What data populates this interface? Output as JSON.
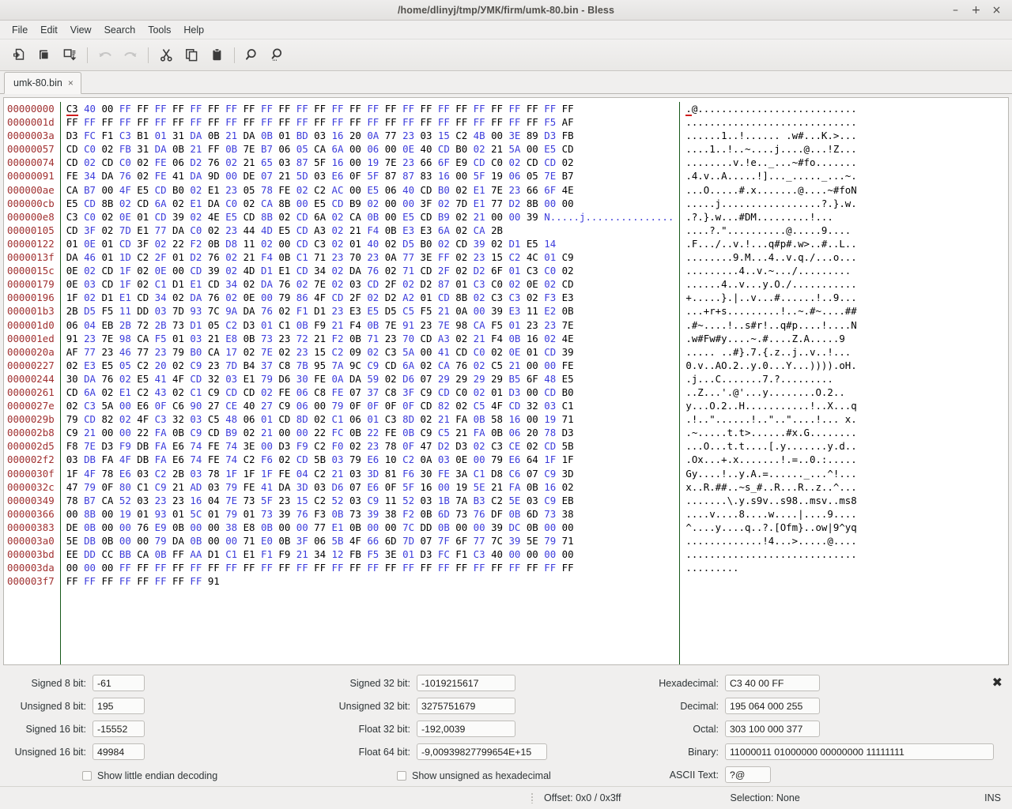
{
  "window": {
    "title": "/home/dlinyj/tmp/УМК/firm/umk-80.bin - Bless",
    "minimize": "–",
    "maximize": "+",
    "close": "×"
  },
  "menubar": {
    "items": [
      {
        "label": "File"
      },
      {
        "label": "Edit"
      },
      {
        "label": "View"
      },
      {
        "label": "Search"
      },
      {
        "label": "Tools"
      },
      {
        "label": "Help"
      }
    ]
  },
  "toolbar": {
    "buttons": [
      {
        "name": "new-icon",
        "tooltip": "New",
        "enabled": true
      },
      {
        "name": "open-icon",
        "tooltip": "Open",
        "enabled": true
      },
      {
        "name": "save-icon",
        "tooltip": "Save",
        "enabled": true
      },
      {
        "name": "undo-icon",
        "tooltip": "Undo",
        "enabled": false
      },
      {
        "name": "redo-icon",
        "tooltip": "Redo",
        "enabled": false
      },
      {
        "name": "cut-icon",
        "tooltip": "Cut",
        "enabled": true
      },
      {
        "name": "copy-icon",
        "tooltip": "Copy",
        "enabled": true
      },
      {
        "name": "paste-icon",
        "tooltip": "Paste",
        "enabled": true
      },
      {
        "name": "find-icon",
        "tooltip": "Find",
        "enabled": true
      },
      {
        "name": "find-replace-icon",
        "tooltip": "Find and Replace",
        "enabled": true
      }
    ]
  },
  "tabs": [
    {
      "label": "umk-80.bin",
      "close": "×",
      "active": true
    }
  ],
  "hexview": {
    "bytes_per_row": 29,
    "rows": [
      {
        "offset": "00000000",
        "hex": "C3 40 00 FF FF FF FF FF FF FF FF FF FF FF FF FF FF FF FF FF FF FF FF FF FF FF FF FF FF",
        "ascii": ".@..........................."
      },
      {
        "offset": "0000001d",
        "hex": "FF FF FF FF FF FF FF FF FF FF FF FF FF FF FF FF FF FF FF FF FF FF FF FF FF FF FF F5 AF",
        "ascii": "............................."
      },
      {
        "offset": "0000003a",
        "hex": "D3 FC F1 C3 B1 01 31 DA 0B 21 DA 0B 01 BD 03 16 20 0A 77 23 03 15 C2 4B 00 3E 89 D3 FB",
        "ascii": "......1..!...... .w#...K.>..."
      },
      {
        "offset": "00000057",
        "hex": "CD C0 02 FB 31 DA 0B 21 FF 0B 7E B7 06 05 CA 6A 00 06 00 0E 40 CD B0 02 21 5A 00 E5 CD",
        "ascii": "....1..!..~....j....@...!Z..."
      },
      {
        "offset": "00000074",
        "hex": "CD 02 CD C0 02 FE 06 D2 76 02 21 65 03 87 5F 16 00 19 7E 23 66 6F E9 CD C0 02 CD CD 02",
        "ascii": "........v.!e.._...~#fo......."
      },
      {
        "offset": "00000091",
        "hex": "FE 34 DA 76 02 FE 41 DA 9D 00 DE 07 21 5D 03 E6 0F 5F 87 87 83 16 00 5F 19 06 05 7E B7",
        "ascii": ".4.v..A.....!]..._....._...~."
      },
      {
        "offset": "000000ae",
        "hex": "CA B7 00 4F E5 CD B0 02 E1 23 05 78 FE 02 C2 AC 00 E5 06 40 CD B0 02 E1 7E 23 66 6F 4E",
        "ascii": "...O.....#.x.......@....~#foN"
      },
      {
        "offset": "000000cb",
        "hex": "E5 CD 8B 02 CD 6A 02 E1 DA C0 02 CA 8B 00 E5 CD B9 02 00 00 3F 02 7D E1 77 D2 8B 00 00",
        "ascii": ".....j.................?.}.w..."
      },
      {
        "offset": "000000e8",
        "hex": "C3 C0 02 0E 01 CD 39 02 4E E5 CD 8B 02 CD 6A 02 CA 0B 00 E5 CD B9 02 21 00 00 39 N.....j..............."
      },
      {
        "offset": "00000105",
        "hex": "CD 3F 02 7D E1 77 DA C0 02 23 44 4D E5 CD A3 02 21 F4 0B E3 E3 6A 02 CA 2B",
        "ascii": ".?.}.w...#DM.........!....j..+"
      },
      {
        "offset": "00000122",
        "hex": "01 0E 01 CD 3F 02 22 F2 0B D8 11 02 00 CD C3 02 01 40 02 D5 B0 02 CD 39 02 D1 E5 14",
        "ascii": "....?.\"..........@.....9...."
      },
      {
        "offset": "0000013f",
        "hex": "DA 46 01 1D C2 2F 01 D2 76 02 21 F4 0B C1 71 23 70 23 0A 77 3E FF 02 23 15 C2 4C 01 C9",
        "ascii": ".F.../..v.!...q#p#.w>..#..L.."
      },
      {
        "offset": "0000015c",
        "hex": "0E 02 CD 1F 02 0E 00 CD 39 02 4D D1 E1 CD 34 02 DA 76 02 71 CD 2F 02 D2 6F 01 C3 C0 02",
        "ascii": "........9.M...4..v.q./...o..."
      },
      {
        "offset": "00000179",
        "hex": "0E 03 CD 1F 02 C1 D1 E1 CD 34 02 DA 76 02 7E 02 03 CD 2F 02 D2 87 01 C3 C0 02 0E 02 CD",
        "ascii": ".........4..v.~.../........."
      },
      {
        "offset": "00000196",
        "hex": "1F 02 D1 E1 CD 34 02 DA 76 02 0E 00 79 86 4F CD 2F 02 D2 A2 01 CD 8B 02 C3 C3 02 F3 E3",
        "ascii": "......4..v...y.O./..........."
      },
      {
        "offset": "000001b3",
        "hex": "2B D5 F5 11 DD 03 7D 93 7C 9A DA 76 02 F1 D1 23 E3 E5 D5 C5 F5 21 0A 00 39 E3 11 E2 0B",
        "ascii": "+.....}.|..v...#......!..9...."
      },
      {
        "offset": "000001d0",
        "hex": "06 04 EB 2B 72 2B 73 D1 05 C2 D3 01 C1 0B F9 21 F4 0B 7E 91 23 7E 98 CA F5 01 23 23 7E",
        "ascii": "...+r+s.........!..~.#~....##~"
      },
      {
        "offset": "000001ed",
        "hex": "91 23 7E 98 CA F5 01 03 21 E8 0B 73 23 72 21 F2 0B 71 23 70 CD A3 02 21 F4 0B 16 02 4E",
        "ascii": ".#~....!..s#r!..q#p....!....N"
      },
      {
        "offset": "0000020a",
        "hex": "AF 77 23 46 77 23 79 B0 CA 17 02 7E 02 23 15 C2 09 02 C3 5A 00 41 CD C0 02 0E 01 CD 39",
        "ascii": ".w#Fw#y....~.#....Z.A.....9"
      },
      {
        "offset": "00000227",
        "hex": "02 E3 E5 05 C2 20 02 C9 23 7D B4 37 C8 7B 95 7A 9C C9 CD 6A 02 CA 76 02 C5 21 00 00 FE",
        "ascii": "..... ..#}.7.{.z..j..v..!..."
      },
      {
        "offset": "00000244",
        "hex": "30 DA 76 02 E5 41 4F CD 32 03 E1 79 D6 30 FE 0A DA 59 02 D6 07 29 29 29 29 B5 6F 48 E5",
        "ascii": "0.v..AO.2..y.0...Y...)))).oH."
      },
      {
        "offset": "00000261",
        "hex": "CD 6A 02 E1 C2 43 02 C1 C9 CD CD 02 FE 06 C8 FE 07 37 C8 3F C9 CD C0 02 01 D3 00 CD B0",
        "ascii": ".j...C.......7.?........."
      },
      {
        "offset": "0000027e",
        "hex": "02 C3 5A 00 E6 0F C6 90 27 CE 40 27 C9 06 00 79 0F 0F 0F 0F CD 82 02 C5 4F CD 32 03 C1",
        "ascii": "..Z...'.@'...y........O.2.."
      },
      {
        "offset": "0000029b",
        "hex": "79 CD 82 02 4F C3 32 03 C5 48 06 01 CD 8D 02 C1 06 01 C3 8D 02 21 FA 0B 58 16 00 19 71",
        "ascii": "y...O.2..H...........!..X...q"
      },
      {
        "offset": "000002b8",
        "hex": "C9 21 00 00 22 FA 0B C9 CD B9 02 21 00 00 22 FC 0B 22 FE 0B C9 C5 21 FA 0B 06 20 78 D3",
        "ascii": ".!..\"......!..\"..\"....!... x."
      },
      {
        "offset": "000002d5",
        "hex": "F8 7E D3 F9 DB FA E6 74 FE 74 3E 00 D3 F9 C2 F0 02 23 78 0F 47 D2 D3 02 C3 CE 02 CD 5B",
        "ascii": ".~.....t.t>......#x.G........["
      },
      {
        "offset": "000002f2",
        "hex": "03 DB FA 4F DB FA E6 74 FE 74 C2 F6 02 CD 5B 03 79 E6 10 C2 0A 03 0E 00 79 E6 64 1F 1F",
        "ascii": "...O...t.t....[.y.......y.d.."
      },
      {
        "offset": "0000030f",
        "hex": "1F 4F 78 E6 03 C2 2B 03 78 1F 1F 1F FE 04 C2 21 03 3D 81 F6 30 FE 3A C1 D8 C6 07 C9 3D",
        "ascii": ".Ox...+.x.......!.=..0.:.....="
      },
      {
        "offset": "0000032c",
        "hex": "47 79 0F 80 C1 C9 21 AD 03 79 FE 41 DA 3D 03 D6 07 E6 0F 5F 16 00 19 5E 21 FA 0B 16 02",
        "ascii": "Gy....!..y.A.=......_...^!...."
      },
      {
        "offset": "00000349",
        "hex": "78 B7 CA 52 03 23 23 16 04 7E 73 5F 23 15 C2 52 03 C9 11 52 03 1B 7A B3 C2 5E 03 C9 EB",
        "ascii": "x..R.##..~s_#..R...R..z..^..."
      },
      {
        "offset": "00000366",
        "hex": "00 8B 00 19 01 93 01 5C 01 79 01 73 39 76 F3 0B 73 39 38 F2 0B 6D 73 76 DF 0B 6D 73 38",
        "ascii": ".......\\.y.s9v..s98..msv..ms8"
      },
      {
        "offset": "00000383",
        "hex": "DE 0B 00 00 76 E9 0B 00 00 38 E8 0B 00 00 77 E1 0B 00 00 7C DD 0B 00 00 39 DC 0B 00 00",
        "ascii": "....v....8....w....|....9...."
      },
      {
        "offset": "000003a0",
        "hex": "5E DB 0B 00 00 79 DA 0B 00 00 71 E0 0B 3F 06 5B 4F 66 6D 7D 07 7F 6F 77 7C 39 5E 79 71",
        "ascii": "^....y....q..?.[Ofm}..ow|9^yq"
      },
      {
        "offset": "000003bd",
        "hex": "EE DD CC BB CA 0B FF AA D1 C1 E1 F1 F9 21 34 12 FB F5 3E 01 D3 FC F1 C3 40 00 00 00 00",
        "ascii": ".............!4...>.....@...."
      },
      {
        "offset": "000003da",
        "hex": "00 00 00 FF FF FF FF FF FF FF FF FF FF FF FF FF FF FF FF FF FF FF FF FF FF FF FF FF FF",
        "ascii": "............................."
      },
      {
        "offset": "000003f7",
        "hex": "FF FF FF FF FF FF FF FF 91",
        "ascii": "........."
      }
    ]
  },
  "inspector": {
    "close_label": "✖",
    "fields": [
      {
        "label": "Signed 8 bit:",
        "value": "-61"
      },
      {
        "label": "Unsigned 8 bit:",
        "value": "195"
      },
      {
        "label": "Signed 16 bit:",
        "value": "-15552"
      },
      {
        "label": "Unsigned 16 bit:",
        "value": "49984"
      },
      {
        "label": "Signed 32 bit:",
        "value": "-1019215617"
      },
      {
        "label": "Unsigned 32 bit:",
        "value": "3275751679"
      },
      {
        "label": "Float 32 bit:",
        "value": "-192,0039"
      },
      {
        "label": "Float 64 bit:",
        "value": "-9,00939827799654E+15"
      },
      {
        "label": "Hexadecimal:",
        "value": "C3 40 00 FF"
      },
      {
        "label": "Decimal:",
        "value": "195 064 000 255"
      },
      {
        "label": "Octal:",
        "value": "303 100 000 377"
      },
      {
        "label": "Binary:",
        "value": "11000011 01000000 00000000 11111111"
      },
      {
        "label": "ASCII Text:",
        "value": "?@"
      }
    ],
    "checkboxes": [
      {
        "label": "Show little endian decoding",
        "checked": false
      },
      {
        "label": "Show unsigned as hexadecimal",
        "checked": false
      }
    ]
  },
  "statusbar": {
    "offset": "Offset: 0x0 / 0x3ff",
    "selection": "Selection: None",
    "mode": "INS"
  },
  "colors": {
    "offset_text": "#a03030",
    "byte_even": "#000000",
    "byte_odd": "#3c3cdc",
    "separator": "#17591b",
    "cursor": "#d01c1c"
  }
}
